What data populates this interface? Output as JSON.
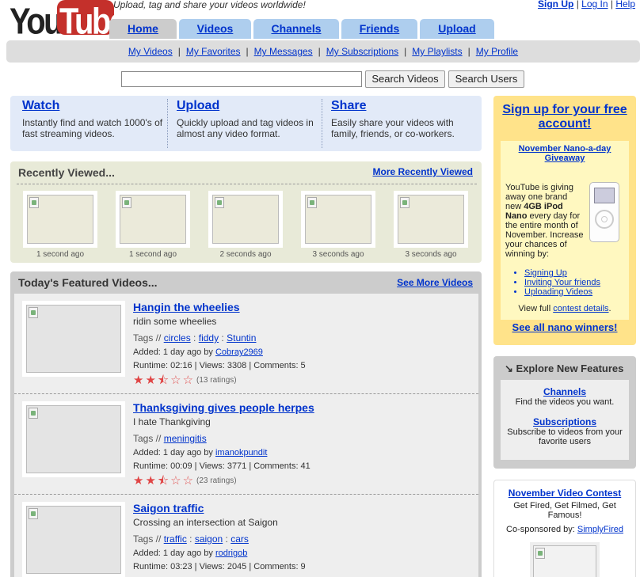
{
  "header": {
    "logo": {
      "you": "You",
      "tube": "Tube"
    },
    "tagline": "Upload, tag and share your videos worldwide!",
    "user_links": {
      "signup": "Sign Up",
      "login": "Log In",
      "help": "Help"
    }
  },
  "tabs": [
    {
      "label": "Home",
      "active": true
    },
    {
      "label": "Videos"
    },
    {
      "label": "Channels"
    },
    {
      "label": "Friends"
    },
    {
      "label": "Upload"
    }
  ],
  "subnav": [
    "My Videos",
    "My Favorites",
    "My Messages",
    "My Subscriptions",
    "My Playlists",
    "My Profile"
  ],
  "search": {
    "value": "",
    "search_videos": "Search Videos",
    "search_users": "Search Users"
  },
  "intro": [
    {
      "title": "Watch",
      "desc": "Instantly find and watch 1000's of fast streaming videos."
    },
    {
      "title": "Upload",
      "desc": "Quickly upload and tag videos in almost any video format."
    },
    {
      "title": "Share",
      "desc": "Easily share your videos with family, friends, or co-workers."
    }
  ],
  "recent": {
    "title": "Recently Viewed...",
    "more": "More Recently Viewed",
    "items": [
      "1 second ago",
      "1 second ago",
      "2 seconds ago",
      "3 seconds ago",
      "3 seconds ago"
    ]
  },
  "featured": {
    "title": "Today's Featured Videos...",
    "more": "See More Videos",
    "videos": [
      {
        "title": "Hangin the wheelies",
        "desc": "ridin some wheelies",
        "tags_label": "Tags //",
        "tags": [
          "circles",
          "fiddy",
          "Stuntin"
        ],
        "added": "Added: 1 day ago by",
        "user": "Cobray2969",
        "runtime": "Runtime: 02:16 | Views: 3308 | Comments: 5",
        "rating": 2.5,
        "ratings": "(13 ratings)"
      },
      {
        "title": "Thanksgiving gives people herpes",
        "desc": "I hate Thankgiving",
        "tags_label": "Tags //",
        "tags": [
          "meningitis"
        ],
        "added": "Added: 1 day ago by",
        "user": "imanokpundit",
        "runtime": "Runtime: 00:09 | Views: 3771 | Comments: 41",
        "rating": 2.5,
        "ratings": "(23 ratings)"
      },
      {
        "title": "Saigon traffic",
        "desc": "Crossing an intersection at Saigon",
        "tags_label": "Tags //",
        "tags": [
          "traffic",
          "saigon",
          "cars"
        ],
        "added": "Added: 1 day ago by",
        "user": "rodrigob",
        "runtime": "Runtime: 03:23 | Views: 2045 | Comments: 9",
        "rating": null,
        "ratings": ""
      }
    ]
  },
  "signup": {
    "title": "Sign up for your free account!",
    "giveaway_title": "November Nano-a-day Giveaway",
    "text_pre": "YouTube is giving away one brand new ",
    "text_bold": "4GB iPod Nano",
    "text_post": " every day for the entire month of November. Increase your chances of winning by:",
    "list": [
      "Signing Up",
      "Inviting Your friends",
      "Uploading Videos"
    ],
    "contest_pre": "View full ",
    "contest_link": "contest details",
    "contest_post": ".",
    "nano_winners": "See all nano winners!"
  },
  "explore": {
    "title": "Explore New Features",
    "features": [
      {
        "name": "Channels",
        "desc": "Find the videos you want."
      },
      {
        "name": "Subscriptions",
        "desc": "Subscribe to videos from your favorite users"
      }
    ]
  },
  "contest": {
    "title": "November Video Contest",
    "desc": "Get Fired, Get Filmed, Get Famous!",
    "cosponsor_label": "Co-sponsored by:",
    "cosponsor": "SimplyFired"
  },
  "colors": {
    "link": "#0033cc",
    "tab": "#aeceee",
    "logo_red": "#c4302b",
    "signup_bg": "#ffe38a",
    "star": "#e04545"
  }
}
